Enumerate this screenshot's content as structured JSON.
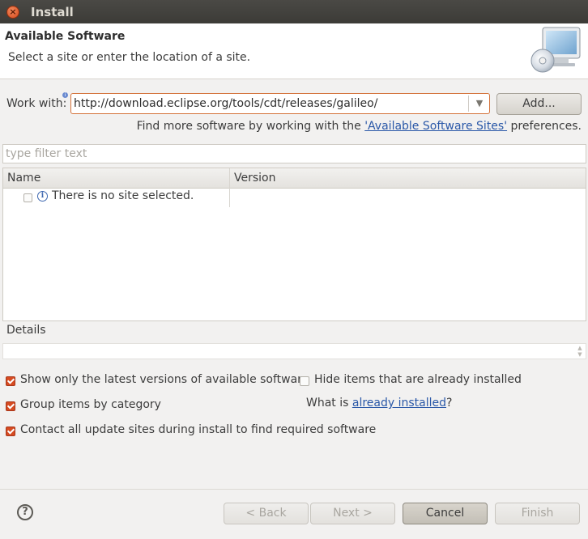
{
  "window": {
    "title": "Install"
  },
  "header": {
    "title": "Available Software",
    "description": "Select a site or enter the location of a site."
  },
  "work_with": {
    "label": "Work with:",
    "value": "http://download.eclipse.org/tools/cdt/releases/galileo/",
    "add_button": "Add..."
  },
  "find_more": {
    "prefix": "Find more software by working with the ",
    "link": "'Available Software Sites'",
    "suffix": " preferences."
  },
  "filter": {
    "placeholder": "type filter text"
  },
  "table": {
    "columns": [
      "Name",
      "Version"
    ],
    "rows": [
      {
        "name": "There is no site selected.",
        "version": ""
      }
    ]
  },
  "details": {
    "label": "Details"
  },
  "options": {
    "show_latest": {
      "label": "Show only the latest versions of available software",
      "checked": true
    },
    "hide_installed": {
      "label": "Hide items that are already installed",
      "checked": false
    },
    "group_by_category": {
      "label": "Group items by category",
      "checked": true
    },
    "contact_all": {
      "label": "Contact all update sites during install to find required software",
      "checked": true
    }
  },
  "already_installed": {
    "prefix": "What is ",
    "link": "already installed",
    "suffix": "?"
  },
  "buttons": {
    "back": "< Back",
    "next": "Next >",
    "cancel": "Cancel",
    "finish": "Finish"
  },
  "colors": {
    "accent": "#d64b21",
    "link": "#2a58a8",
    "titlebar": "#3c3b37"
  }
}
